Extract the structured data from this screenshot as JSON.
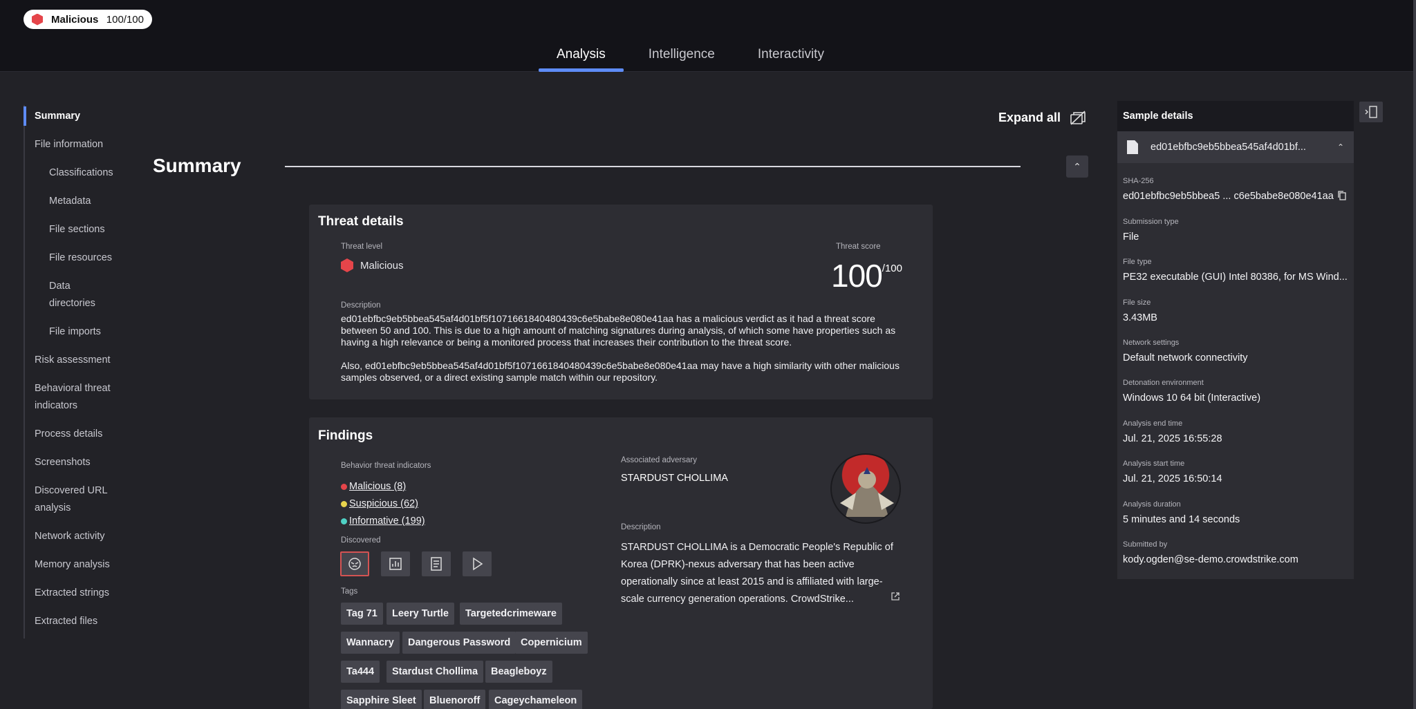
{
  "header": {
    "verdict_label": "Malicious",
    "verdict_score": "100/100",
    "tabs": [
      {
        "label": "Analysis",
        "active": true
      },
      {
        "label": "Intelligence",
        "active": false
      },
      {
        "label": "Interactivity",
        "active": false
      }
    ]
  },
  "nav": {
    "items": [
      {
        "label": "Summary"
      },
      {
        "label": "File information"
      },
      {
        "label": "Classifications"
      },
      {
        "label": "Metadata"
      },
      {
        "label": "File sections"
      },
      {
        "label": "File resources"
      },
      {
        "label": "Data directories"
      },
      {
        "label": "File imports"
      },
      {
        "label": "Risk assessment"
      },
      {
        "label": "Behavioral threat indicators"
      },
      {
        "label": "Process details"
      },
      {
        "label": "Screenshots"
      },
      {
        "label": "Discovered URL analysis"
      },
      {
        "label": "Network activity"
      },
      {
        "label": "Memory analysis"
      },
      {
        "label": "Extracted strings"
      },
      {
        "label": "Extracted files"
      }
    ]
  },
  "main": {
    "title": "Summary",
    "expand_all": "Expand all",
    "threat": {
      "title": "Threat details",
      "level_label": "Threat level",
      "level_value": "Malicious",
      "score_label": "Threat score",
      "score_value": "100",
      "score_max": "/100",
      "description_label": "Description",
      "description_1": "ed01ebfbc9eb5bbea545af4d01bf5f1071661840480439c6e5babe8e080e41aa has a malicious verdict as it had a threat score between 50 and 100. This is due to a high amount of matching signatures during analysis, of which some have properties such as having a high relevance or being a monitored process that increases their contribution to the threat score.",
      "description_2": "Also, ed01ebfbc9eb5bbea545af4d01bf5f1071661840480439c6e5babe8e080e41aa may have a high similarity with other malicious samples observed, or a direct existing sample match within our repository."
    },
    "findings": {
      "title": "Findings",
      "bti_label": "Behavior threat indicators",
      "bti": [
        {
          "label": "Malicious (8)",
          "color": "#e5454a"
        },
        {
          "label": "Suspicious (62)",
          "color": "#e8d44d"
        },
        {
          "label": "Informative (199)",
          "color": "#4fd1c5"
        }
      ],
      "discovered_label": "Discovered",
      "discovered_icons": [
        "adversary-icon",
        "chart-icon",
        "document-icon",
        "play-icon"
      ],
      "tags_label": "Tags",
      "tags": [
        "Tag 71",
        "Leery Turtle",
        "Targetedcrimeware",
        "Wannacry",
        "Dangerous Password",
        "Copernicium",
        "Ta444",
        "Stardust Chollima",
        "Beagleboyz",
        "Sapphire Sleet",
        "Bluenoroff",
        "Cageychameleon"
      ],
      "adversary_label": "Associated adversary",
      "adversary_name": "STARDUST CHOLLIMA",
      "adversary_desc_label": "Description",
      "adversary_desc": "STARDUST CHOLLIMA is a Democratic People's Republic of Korea (DPRK)-nexus adversary that has been active operationally since at least 2015 and is affiliated with large-scale currency generation operations. CrowdStrike..."
    }
  },
  "sample": {
    "header": "Sample details",
    "file_name": "ed01ebfbc9eb5bbea545af4d01bf...",
    "fields": [
      {
        "label": "SHA-256",
        "value": "ed01ebfbc9eb5bbea5 ... c6e5babe8e080e41aa"
      },
      {
        "label": "Submission type",
        "value": "File"
      },
      {
        "label": "File type",
        "value": "PE32 executable (GUI) Intel 80386, for MS Wind..."
      },
      {
        "label": "File size",
        "value": "3.43MB"
      },
      {
        "label": "Network settings",
        "value": "Default network connectivity"
      },
      {
        "label": "Detonation environment",
        "value": "Windows 10 64 bit (Interactive)"
      },
      {
        "label": "Analysis end time",
        "value": "Jul. 21, 2025 16:55:28"
      },
      {
        "label": "Analysis start time",
        "value": "Jul. 21, 2025 16:50:14"
      },
      {
        "label": "Analysis duration",
        "value": "5 minutes and 14 seconds"
      },
      {
        "label": "Submitted by",
        "value": "kody.ogden@se-demo.crowdstrike.com"
      }
    ]
  }
}
